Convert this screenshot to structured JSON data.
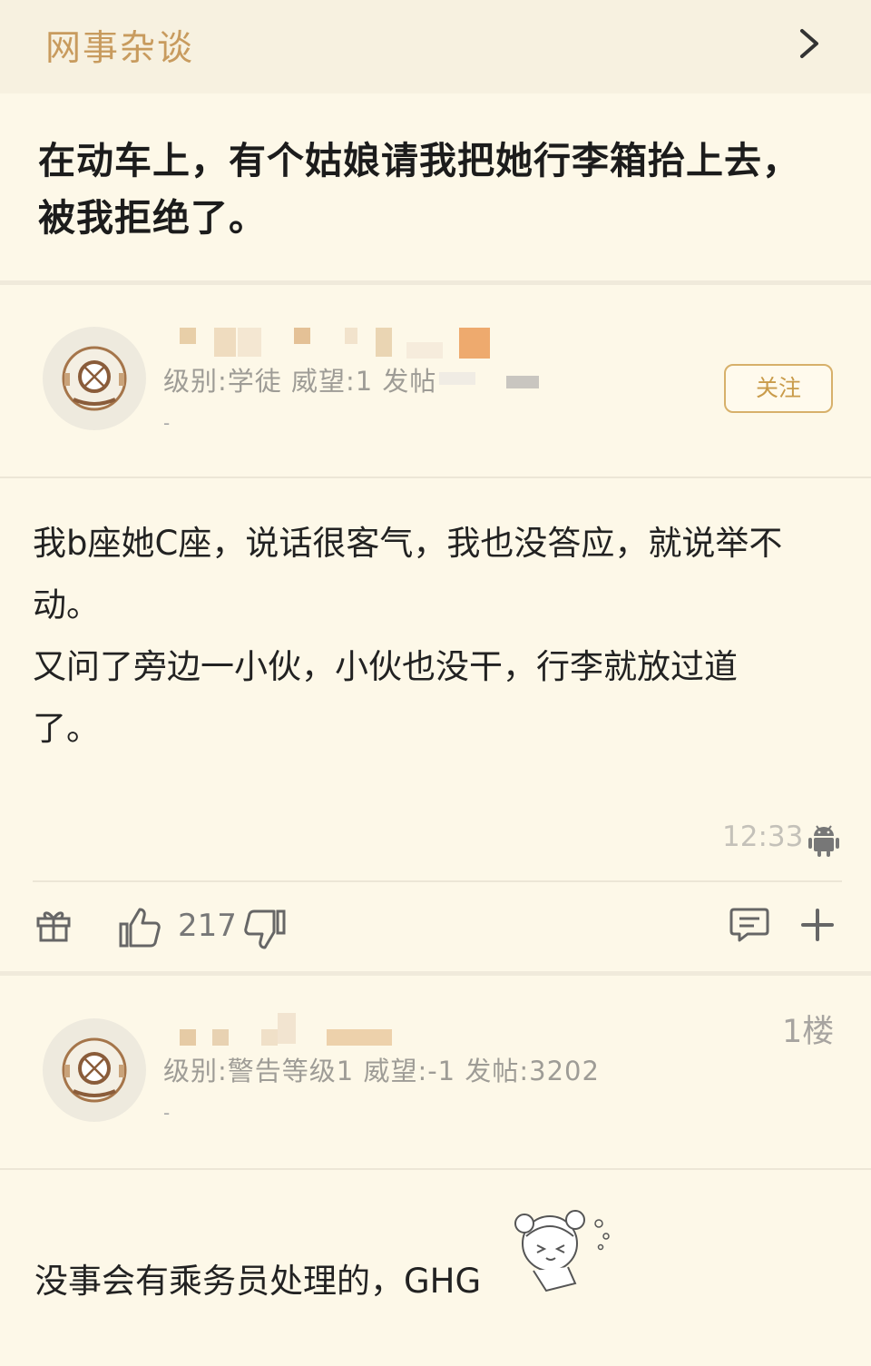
{
  "header": {
    "board_name": "网事杂谈",
    "chevron_icon": "chevron-right-icon"
  },
  "thread": {
    "title": "在动车上，有个姑娘请我把她行李箱抬上去，被我拒绝了。"
  },
  "op": {
    "meta_line": "级别:学徒 威望:1 发帖",
    "meta_sub": "-",
    "follow_label": "关注",
    "body_lines": [
      "我b座她C座，说话很客气，我也没答应，就说举不",
      "动。",
      "又问了旁边一小伙，小伙也没干，行李就放过道",
      "了。"
    ],
    "time": "12:33",
    "platform_icon": "android-icon",
    "like_count": "217",
    "actions": [
      "gift-icon",
      "thumbs-up-icon",
      "thumbs-down-icon",
      "comment-icon",
      "plus-icon"
    ]
  },
  "reply": {
    "floor_label": "1楼",
    "meta_line": "级别:警告等级1 威望:-1 发帖:3202",
    "meta_sub": "-",
    "body_text": "没事会有乘务员处理的，GHG"
  },
  "colors": {
    "background": "#fdf8e8",
    "accent": "#c89b5e",
    "follow_border": "#d7b06a"
  }
}
